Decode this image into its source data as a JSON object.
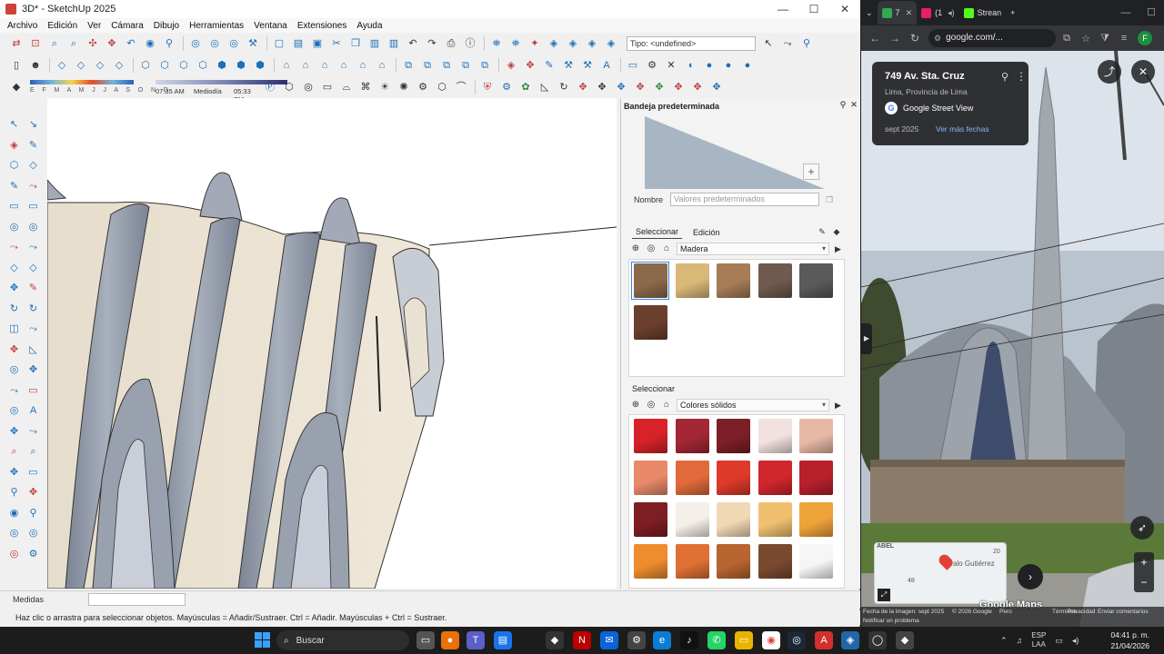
{
  "sketchup": {
    "title": "3D* - SketchUp 2025",
    "menu": [
      "Archivo",
      "Edición",
      "Ver",
      "Cámara",
      "Dibujo",
      "Herramientas",
      "Ventana",
      "Extensiones",
      "Ayuda"
    ],
    "tipo_field": "Tipo: <undefined>",
    "shadow": {
      "months": "E F M A M J J A S O N D",
      "time_start": "07:35 AM",
      "time_mid": "Mediodía",
      "time_end": "05:33 PM"
    },
    "tray": {
      "title": "Bandeja predeterminada",
      "name_label": "Nombre",
      "name_placeholder": "Valores predeterminados",
      "tab_select": "Seleccionar",
      "tab_edit": "Edición",
      "library_1": "Madera",
      "select_label_2": "Seleccionar",
      "library_2": "Colores sólidos",
      "wood_swatches": [
        "#8a6a4a",
        "#d9b878",
        "#a67d57",
        "#6e5a4e",
        "#5a5a5a",
        "#6b3f2e"
      ],
      "solid_swatches": [
        "#d8222a",
        "#a32735",
        "#7d1f27",
        "#f1e1df",
        "#e8b8a6",
        "#e8896a",
        "#e06a3a",
        "#dd3a2a",
        "#d1262b",
        "#b8202c",
        "#7d1e22",
        "#f5efe9",
        "#f1d8b5",
        "#f0c070",
        "#eea33a",
        "#ef8c2e",
        "#e07034",
        "#b86530",
        "#7a4a30",
        "#f6f6f6"
      ]
    },
    "measures_label": "Medidas",
    "status_hint": "Haz clic o arrastra para seleccionar objetos. Mayúsculas = Añadir/Sustraer. Ctrl = Añadir. Mayúsculas + Ctrl = Sustraer.",
    "win_controls": [
      "—",
      "☐",
      "✕"
    ]
  },
  "chrome": {
    "tabs": [
      {
        "label": "7",
        "color": "#34a853"
      },
      {
        "label": "(1",
        "color": "#e91e63"
      },
      {
        "label": "Strean",
        "color": "#53fc18"
      }
    ],
    "url": "google.com/...",
    "profile_initial": "F",
    "streetview": {
      "address": "749 Av. Sta. Cruz",
      "city": "Lima, Provincia de Lima",
      "service": "Google Street View",
      "date": "sept 2025",
      "more_dates": "Ver más fechas",
      "map_labels": [
        "ABEL",
        "20",
        "48",
        "valo Gutiérrez"
      ],
      "brand": "Google Maps",
      "footer": [
        "Fecha de la imagen: sept 2025",
        "© 2026 Google",
        "Perú",
        "Términos",
        "Privacidad",
        "Enviar comentarios",
        "Notificar un problema"
      ]
    }
  },
  "taskbar": {
    "search": "Buscar",
    "lang_1": "ESP",
    "lang_2": "LAA",
    "time": "04:41 p. m.",
    "date": "21/04/2026"
  }
}
